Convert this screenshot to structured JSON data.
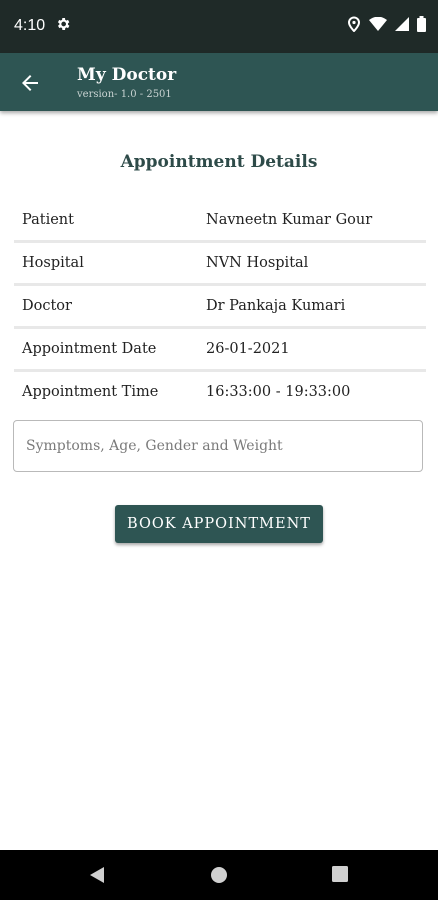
{
  "status_bar": {
    "time": "4:10"
  },
  "app_bar": {
    "title": "My Doctor",
    "subtitle": "version- 1.0 - 2501"
  },
  "heading": "Appointment Details",
  "details": [
    {
      "label": "Patient",
      "value": "Navneetn Kumar Gour"
    },
    {
      "label": "Hospital",
      "value": "NVN Hospital"
    },
    {
      "label": "Doctor",
      "value": "Dr Pankaja Kumari"
    },
    {
      "label": "Appointment Date",
      "value": "26-01-2021"
    },
    {
      "label": "Appointment Time",
      "value": "16:33:00 - 19:33:00"
    }
  ],
  "symptoms_input": {
    "value": "",
    "placeholder": "Symptoms, Age, Gender and Weight"
  },
  "book_button": {
    "label": "BOOK APPOINTMENT"
  },
  "colors": {
    "primary": "#2e5553",
    "status_bar": "#1f2a28",
    "heading": "#2e4b49"
  },
  "icons": {
    "back": "arrow-left-icon",
    "settings": "gear-icon",
    "location": "location-pin-icon",
    "wifi": "wifi-icon",
    "signal": "signal-icon",
    "battery": "battery-icon",
    "nav_back": "triangle-back-icon",
    "nav_home": "circle-home-icon",
    "nav_recents": "square-recents-icon"
  }
}
